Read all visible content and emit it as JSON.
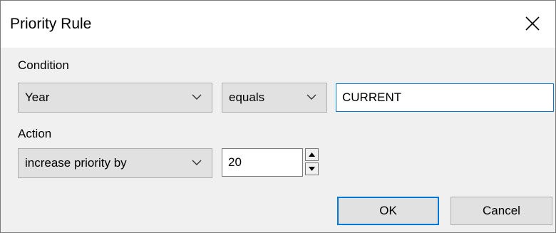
{
  "window": {
    "title": "Priority Rule",
    "close_icon": "close-icon"
  },
  "condition": {
    "label": "Condition",
    "field_value": "Year",
    "operator_value": "equals",
    "text_value": "CURRENT"
  },
  "action": {
    "label": "Action",
    "action_value": "increase priority by",
    "amount_value": "20"
  },
  "buttons": {
    "ok_label": "OK",
    "cancel_label": "Cancel"
  },
  "colors": {
    "accent": "#0078d7",
    "dialog_bg": "#f0f0f0",
    "control_bg": "#e1e1e1"
  }
}
